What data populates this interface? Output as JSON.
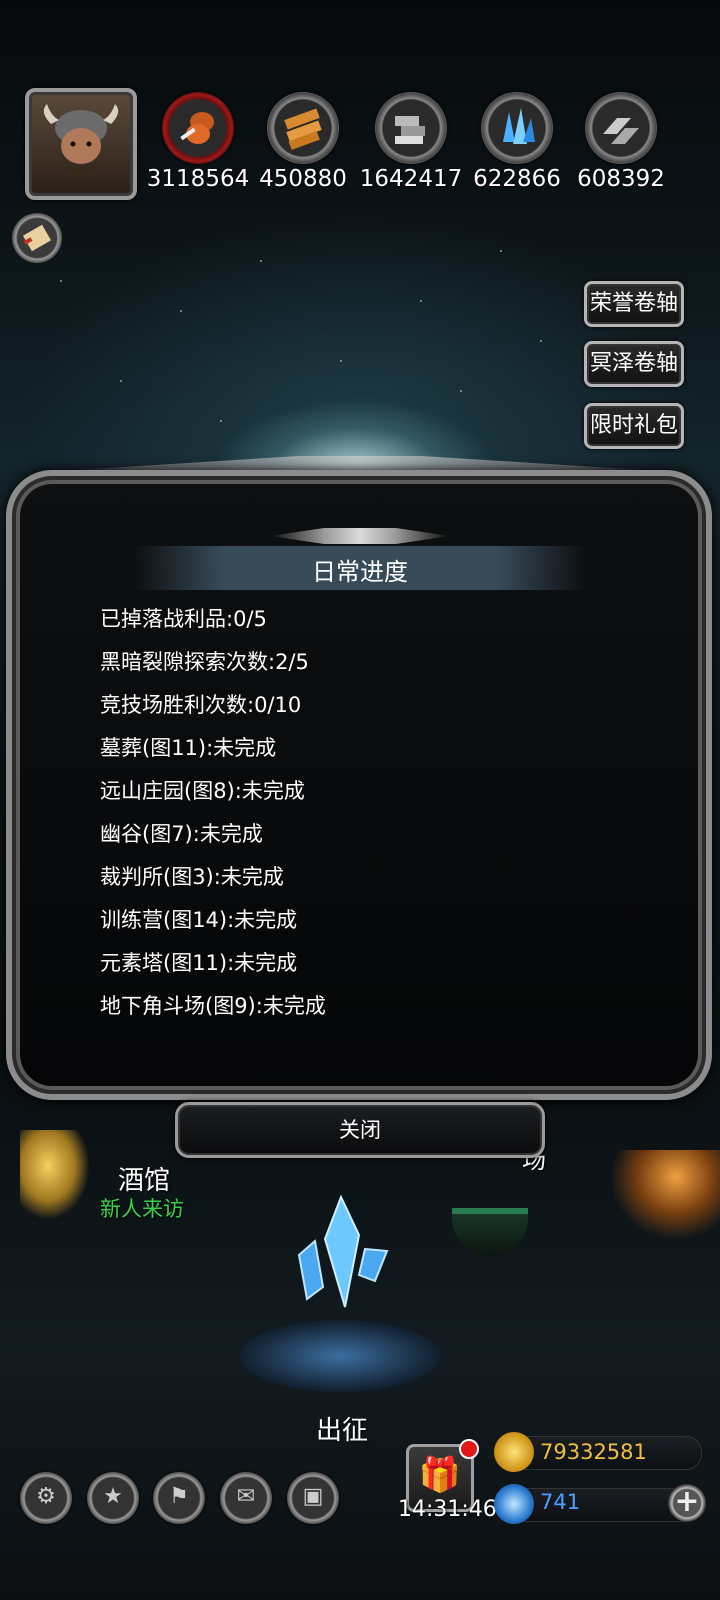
{
  "resources": [
    {
      "icon": "meat-icon",
      "value": "3118564"
    },
    {
      "icon": "wood-icon",
      "value": "450880"
    },
    {
      "icon": "iron-icon",
      "value": "1642417"
    },
    {
      "icon": "crystal-icon",
      "value": "622866"
    },
    {
      "icon": "steel-icon",
      "value": "608392"
    }
  ],
  "side_buttons": [
    "荣誉卷轴",
    "冥泽卷轴",
    "限时礼包"
  ],
  "modal": {
    "title": "日常进度",
    "items": [
      "已掉落战利品:0/5",
      "黑暗裂隙探索次数:2/5",
      "竞技场胜利次数:0/10",
      "墓葬(图11):未完成",
      "远山庄园(图8):未完成",
      "幽谷(图7):未完成",
      "裁判所(图3):未完成",
      "训练营(图14):未完成",
      "元素塔(图11):未完成",
      "地下角斗场(图9):未完成"
    ],
    "close_label": "关闭"
  },
  "town": {
    "tavern_name": "酒馆",
    "tavern_sub": "新人来访",
    "arena_partial": "场",
    "expedition": "出征"
  },
  "bottom": {
    "icons": [
      "settings-icon",
      "star-icon",
      "banner-icon",
      "mail-icon",
      "chest-icon"
    ],
    "timer": "14:31:46",
    "gold": "79332581",
    "gems": "741",
    "gold_color": "#f0c040",
    "gem_color": "#4aa0ff"
  }
}
